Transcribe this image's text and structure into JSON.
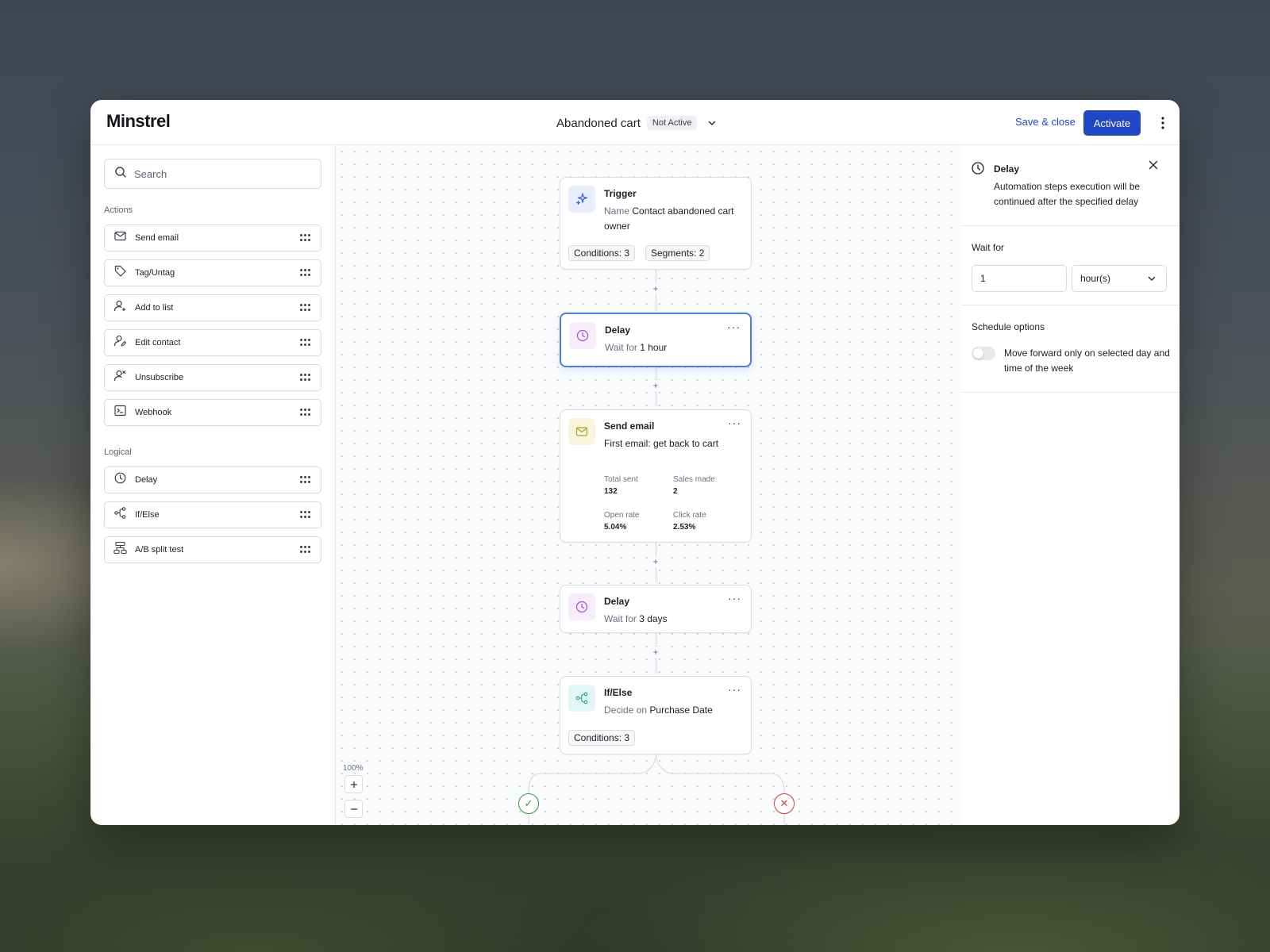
{
  "app": {
    "logo": "Minstrel"
  },
  "header": {
    "flow_title": "Abandoned cart",
    "status": "Not Active",
    "save_close": "Save & close",
    "activate": "Activate"
  },
  "sidebar": {
    "search_placeholder": "Search",
    "actions_label": "Actions",
    "actions": [
      {
        "label": "Send email",
        "icon": "mail-icon"
      },
      {
        "label": "Tag/Untag",
        "icon": "tag-icon"
      },
      {
        "label": "Add to list",
        "icon": "user-plus-icon"
      },
      {
        "label": "Edit contact",
        "icon": "user-edit-icon"
      },
      {
        "label": "Unsubscribe",
        "icon": "user-x-icon"
      },
      {
        "label": "Webhook",
        "icon": "terminal-icon"
      }
    ],
    "logical_label": "Logical",
    "logical": [
      {
        "label": "Delay",
        "icon": "clock-icon"
      },
      {
        "label": "If/Else",
        "icon": "branch-icon"
      },
      {
        "label": "A/B split test",
        "icon": "split-icon"
      }
    ]
  },
  "canvas": {
    "zoom": "100%",
    "nodes": {
      "trigger": {
        "title": "Trigger",
        "name_label": "Name",
        "name_value": "Contact abandoned cart owner",
        "chip_conditions": "Conditions: 3",
        "chip_segments": "Segments: 2"
      },
      "delay1": {
        "title": "Delay",
        "prefix": "Wait for",
        "value": "1 hour"
      },
      "send_email": {
        "title": "Send email",
        "subtitle": "First email: get back to cart",
        "stats": {
          "total_sent_label": "Total sent",
          "total_sent": "132",
          "sales_made_label": "Sales made",
          "sales_made": "2",
          "open_rate_label": "Open rate",
          "open_rate": "5.04%",
          "click_rate_label": "Click rate",
          "click_rate": "2.53%"
        }
      },
      "delay2": {
        "title": "Delay",
        "prefix": "Wait for",
        "value": "3 days"
      },
      "ifelse": {
        "title": "If/Else",
        "prefix": "Decide on",
        "value": "Purchase Date",
        "chip_conditions": "Conditions: 3"
      }
    },
    "menu_glyph": "···",
    "plus_glyph": "+",
    "yes_glyph": "✓",
    "no_glyph": "✕"
  },
  "panel": {
    "title": "Delay",
    "description": "Automation steps execution will be continued after the specified delay",
    "wait_for_label": "Wait for",
    "wait_value": "1",
    "wait_unit": "hour(s)",
    "schedule_label": "Schedule options",
    "schedule_toggle_label": "Move forward only on selected day and time of the week",
    "schedule_toggle_on": false
  },
  "colors": {
    "accent": "#1f47c6",
    "selected_border": "#4b7be5",
    "yes": "#2f9e44",
    "no": "#d63b3b"
  }
}
